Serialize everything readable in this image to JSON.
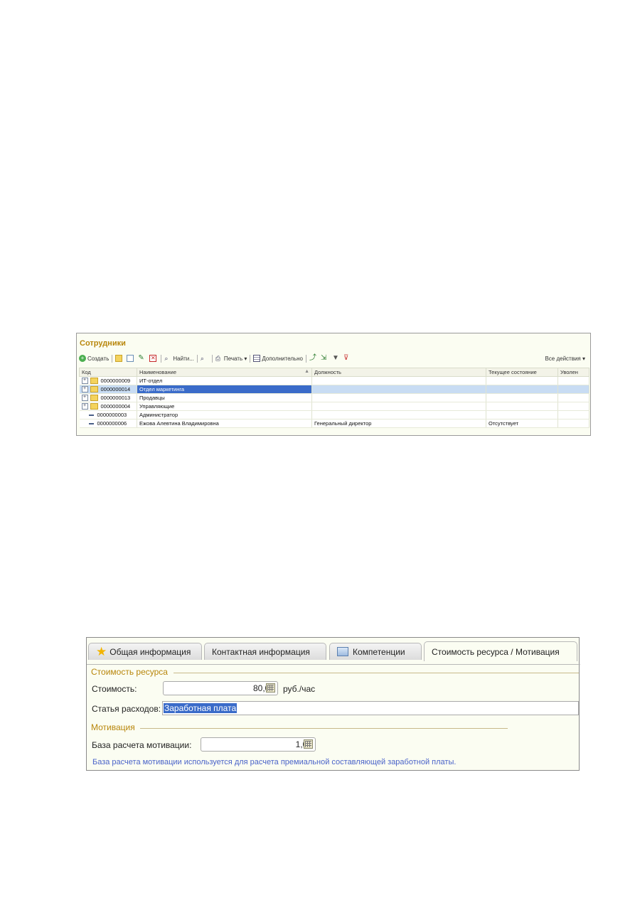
{
  "catalog": {
    "title": "Сотрудники",
    "toolbar": {
      "create": "Создать",
      "find": "Найти...",
      "print": "Печать",
      "extra": "Дополнительно",
      "all_actions": "Все действия"
    },
    "columns": [
      "Код",
      "Наименование",
      "Должность",
      "Текущее состояние",
      "Уволен"
    ],
    "rows": [
      {
        "code": "0000000009",
        "name": "ИТ-отдел",
        "position": "",
        "state": "",
        "fired": "",
        "type": "folder"
      },
      {
        "code": "0000000014",
        "name": "Отдел маркетинга",
        "position": "",
        "state": "",
        "fired": "",
        "type": "folder",
        "selected": true
      },
      {
        "code": "0000000013",
        "name": "Продавцы",
        "position": "",
        "state": "",
        "fired": "",
        "type": "folder"
      },
      {
        "code": "0000000004",
        "name": "Управляющие",
        "position": "",
        "state": "",
        "fired": "",
        "type": "folder"
      },
      {
        "code": "0000000003",
        "name": "Администратор",
        "position": "",
        "state": "",
        "fired": "",
        "type": "item"
      },
      {
        "code": "0000000006",
        "name": "Ежова Алевтина Владимировна",
        "position": "Генеральный директор",
        "state": "Отсутствует",
        "fired": "",
        "type": "item"
      }
    ]
  },
  "form": {
    "tabs": [
      "Общая информация",
      "Контактная информация",
      "Компетенции",
      "Стоимость ресурса / Мотивация"
    ],
    "active_tab": 3,
    "resource_group": "Стоимость ресурса",
    "cost_label": "Стоимость:",
    "cost_value": "80,00",
    "cost_unit": "руб./час",
    "expense_label": "Статья расходов:",
    "expense_value": "Заработная плата",
    "motivation_group": "Мотивация",
    "motivation_label": "База расчета мотивации:",
    "motivation_value": "1,00",
    "note": "База расчета мотивации  используется для расчета премиальной составляющей заработной платы."
  }
}
